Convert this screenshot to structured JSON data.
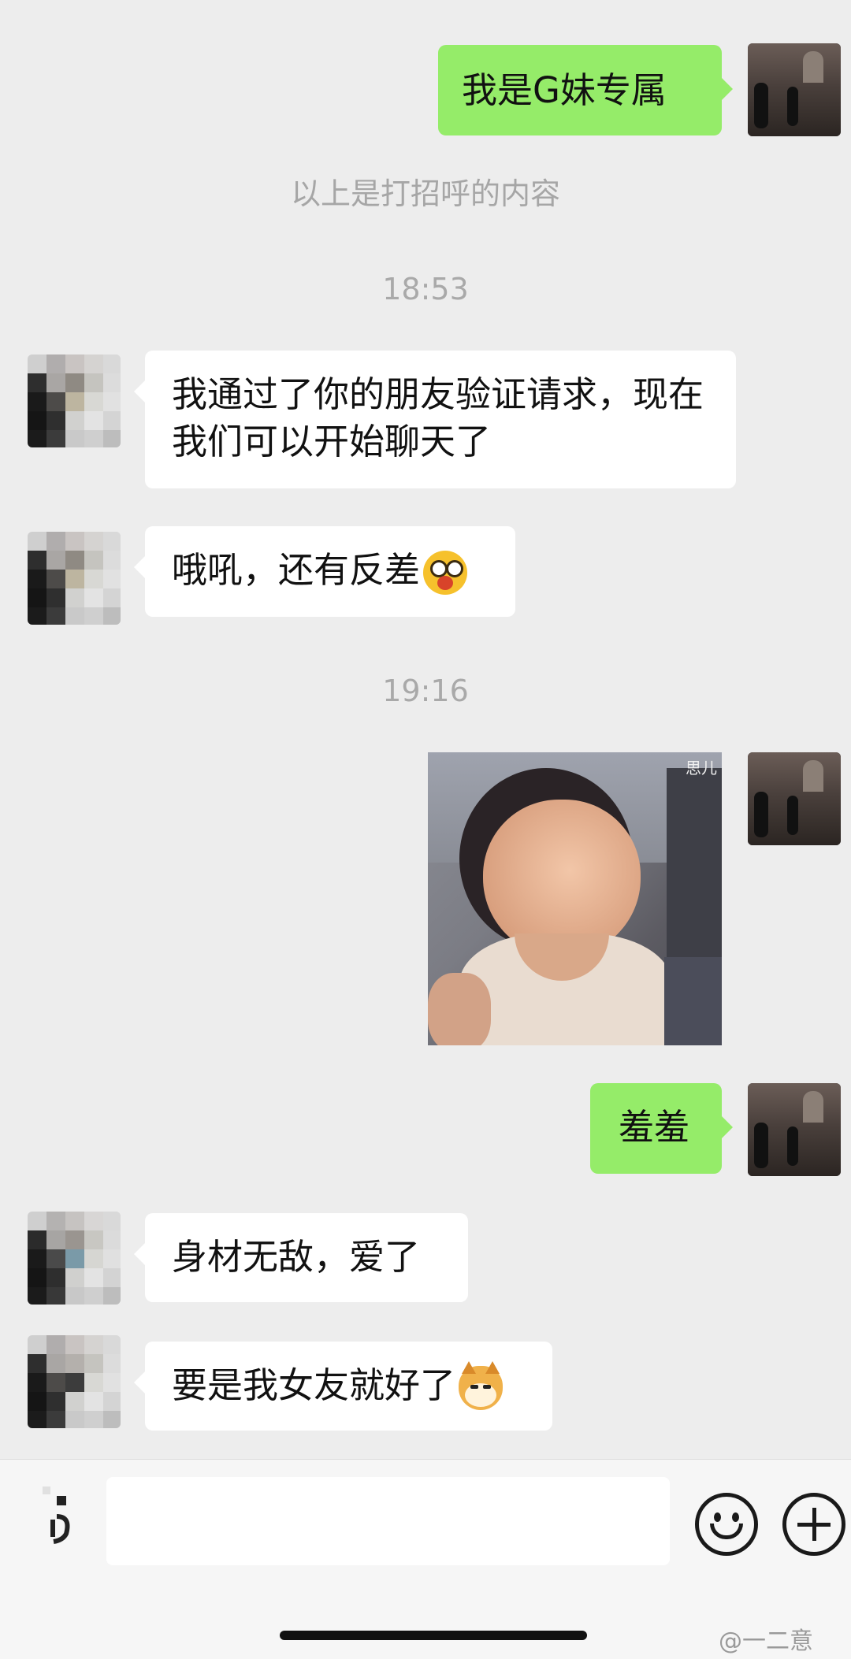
{
  "messages": {
    "m1": "我是G妹专属",
    "sys1": "以上是打招呼的内容",
    "time1": "18:53",
    "m2": "我通过了你的朋友验证请求，现在我们可以开始聊天了",
    "m3": "哦吼，还有反差",
    "time2": "19:16",
    "photo_tag": "思儿",
    "m4": "羞羞",
    "m5": "身材无敌，爱了",
    "m6": "要是我女友就好了"
  },
  "icons": {
    "voice": "voice-icon",
    "emoji": "emoji-icon",
    "plus": "plus-icon"
  },
  "watermark": "@一二意",
  "colors": {
    "sent_bubble": "#95ec69",
    "received_bubble": "#ffffff",
    "background": "#ededed"
  }
}
